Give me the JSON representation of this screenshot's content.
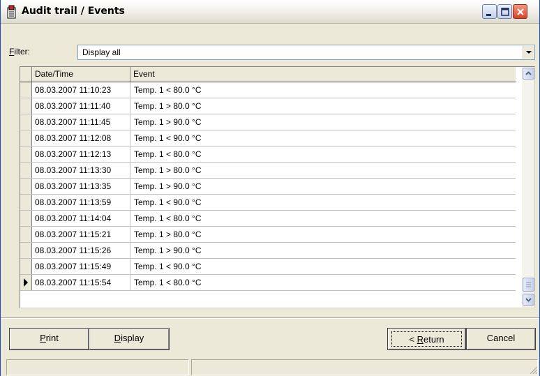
{
  "window": {
    "title": "Audit trail / Events"
  },
  "filter": {
    "label_mnemonic": "F",
    "label_rest": "ilter:",
    "selected": "Display all"
  },
  "grid": {
    "columns": [
      "Date/Time",
      "Event"
    ],
    "rows": [
      {
        "datetime": "08.03.2007 11:10:23",
        "event": "Temp. 1 <  80.0 °C"
      },
      {
        "datetime": "08.03.2007 11:11:40",
        "event": "Temp. 1 >  80.0 °C"
      },
      {
        "datetime": "08.03.2007 11:11:45",
        "event": "Temp. 1 >  90.0 °C"
      },
      {
        "datetime": "08.03.2007 11:12:08",
        "event": "Temp. 1 <  90.0 °C"
      },
      {
        "datetime": "08.03.2007 11:12:13",
        "event": "Temp. 1 <  80.0 °C"
      },
      {
        "datetime": "08.03.2007 11:13:30",
        "event": "Temp. 1 >  80.0 °C"
      },
      {
        "datetime": "08.03.2007 11:13:35",
        "event": "Temp. 1 >  90.0 °C"
      },
      {
        "datetime": "08.03.2007 11:13:59",
        "event": "Temp. 1 <  90.0 °C"
      },
      {
        "datetime": "08.03.2007 11:14:04",
        "event": "Temp. 1 <  80.0 °C"
      },
      {
        "datetime": "08.03.2007 11:15:21",
        "event": "Temp. 1 >  80.0 °C"
      },
      {
        "datetime": "08.03.2007 11:15:26",
        "event": "Temp. 1 >  90.0 °C"
      },
      {
        "datetime": "08.03.2007 11:15:49",
        "event": "Temp. 1 <  90.0 °C"
      },
      {
        "datetime": "08.03.2007 11:15:54",
        "event": "Temp. 1 <  80.0 °C"
      }
    ],
    "current_row": 12
  },
  "buttons": {
    "print": {
      "mnemonic": "P",
      "rest": "rint"
    },
    "display": {
      "mnemonic": "D",
      "rest": "isplay"
    },
    "return": {
      "prefix": "< ",
      "mnemonic": "R",
      "rest": "eturn"
    },
    "cancel": "Cancel"
  },
  "colors": {
    "title_close": "#d8452a",
    "window_bg": "#ece9d8",
    "xp_blue": "#1f4fc8"
  },
  "icons": [
    "app-icon",
    "minimize-icon",
    "maximize-icon",
    "close-icon",
    "chevron-down-icon",
    "scroll-up-icon",
    "scroll-down-icon",
    "row-pointer-icon",
    "resize-grip-icon"
  ]
}
